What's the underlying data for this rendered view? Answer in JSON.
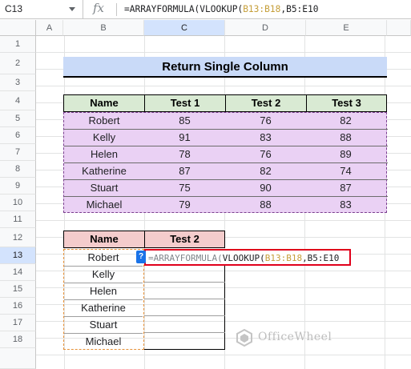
{
  "formula_bar": {
    "name_box": "C13",
    "fx_label": "fx",
    "formula_prefix": "=ARRAYFORMULA(VLOOKUP(",
    "formula_ref": "B13:B18",
    "formula_suffix": ",B5:E10"
  },
  "columns": [
    "A",
    "B",
    "C",
    "D",
    "E"
  ],
  "rows": [
    "1",
    "2",
    "3",
    "4",
    "5",
    "6",
    "7",
    "8",
    "9",
    "10",
    "11",
    "12",
    "13",
    "14",
    "15",
    "16",
    "17",
    "18"
  ],
  "title": "Return Single Column",
  "table1": {
    "headers": [
      "Name",
      "Test 1",
      "Test 2",
      "Test 3"
    ],
    "rows": [
      [
        "Robert",
        "85",
        "76",
        "82"
      ],
      [
        "Kelly",
        "91",
        "83",
        "88"
      ],
      [
        "Helen",
        "78",
        "76",
        "89"
      ],
      [
        "Katherine",
        "87",
        "82",
        "74"
      ],
      [
        "Stuart",
        "75",
        "90",
        "87"
      ],
      [
        "Michael",
        "79",
        "88",
        "83"
      ]
    ]
  },
  "table2": {
    "headers": [
      "Name",
      "Test 2"
    ],
    "names": [
      "Robert",
      "Kelly",
      "Helen",
      "Katherine",
      "Stuart",
      "Michael"
    ]
  },
  "active_cell": {
    "help_badge": "?",
    "formula_prefix": "=ARRAYFORMULA(",
    "formula_func": "VLOOKUP(",
    "formula_ref": "B13:B18",
    "formula_suffix": ",B5:E10"
  },
  "watermark": {
    "text": "OfficeWheel"
  },
  "colors": {
    "header_green": "#d9ead3",
    "title_blue": "#c9daf8",
    "header_red": "#f4cccc",
    "range_purple": "#ead1f4",
    "active_border": "#e0001b"
  }
}
